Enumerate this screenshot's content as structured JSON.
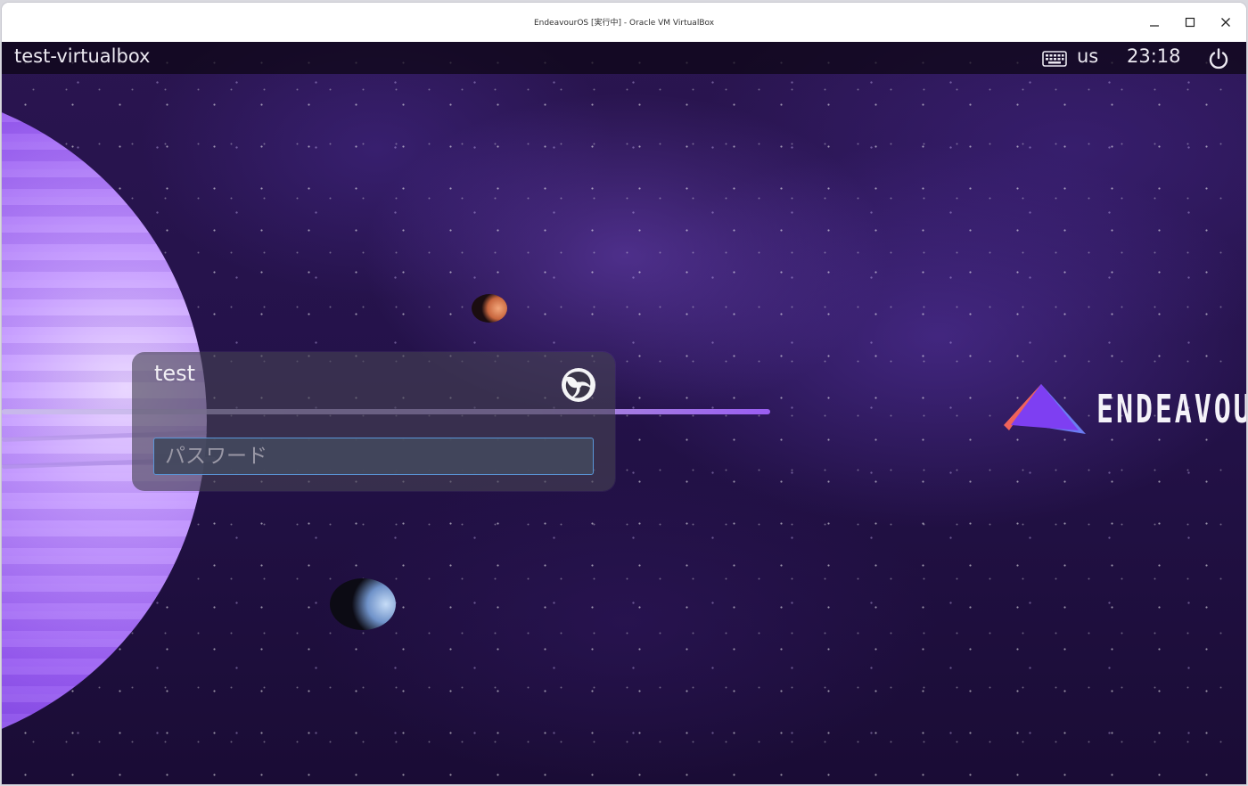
{
  "window": {
    "title": "EndeavourOS [実行中] - Oracle VM VirtualBox",
    "controls": [
      "minimize-icon",
      "maximize-icon",
      "close-icon"
    ]
  },
  "topbar": {
    "hostname": "test-virtualbox",
    "keyboard_icon": "keyboard-icon",
    "keyboard_layout": "us",
    "time": "23:18",
    "power_icon": "power-icon"
  },
  "login": {
    "username": "test",
    "session_icon": "session-logo-icon",
    "password_placeholder": "パスワード",
    "password_value": ""
  },
  "wallpaper": {
    "brand_text": "ENDEAVOUR",
    "colors": {
      "space": "#24124a",
      "planet": "#9a5ef2",
      "input_focus": "#5a96d8",
      "logo_red": "#f0625a",
      "logo_purple": "#7e3ff2",
      "logo_blue": "#6b7cf2"
    }
  }
}
